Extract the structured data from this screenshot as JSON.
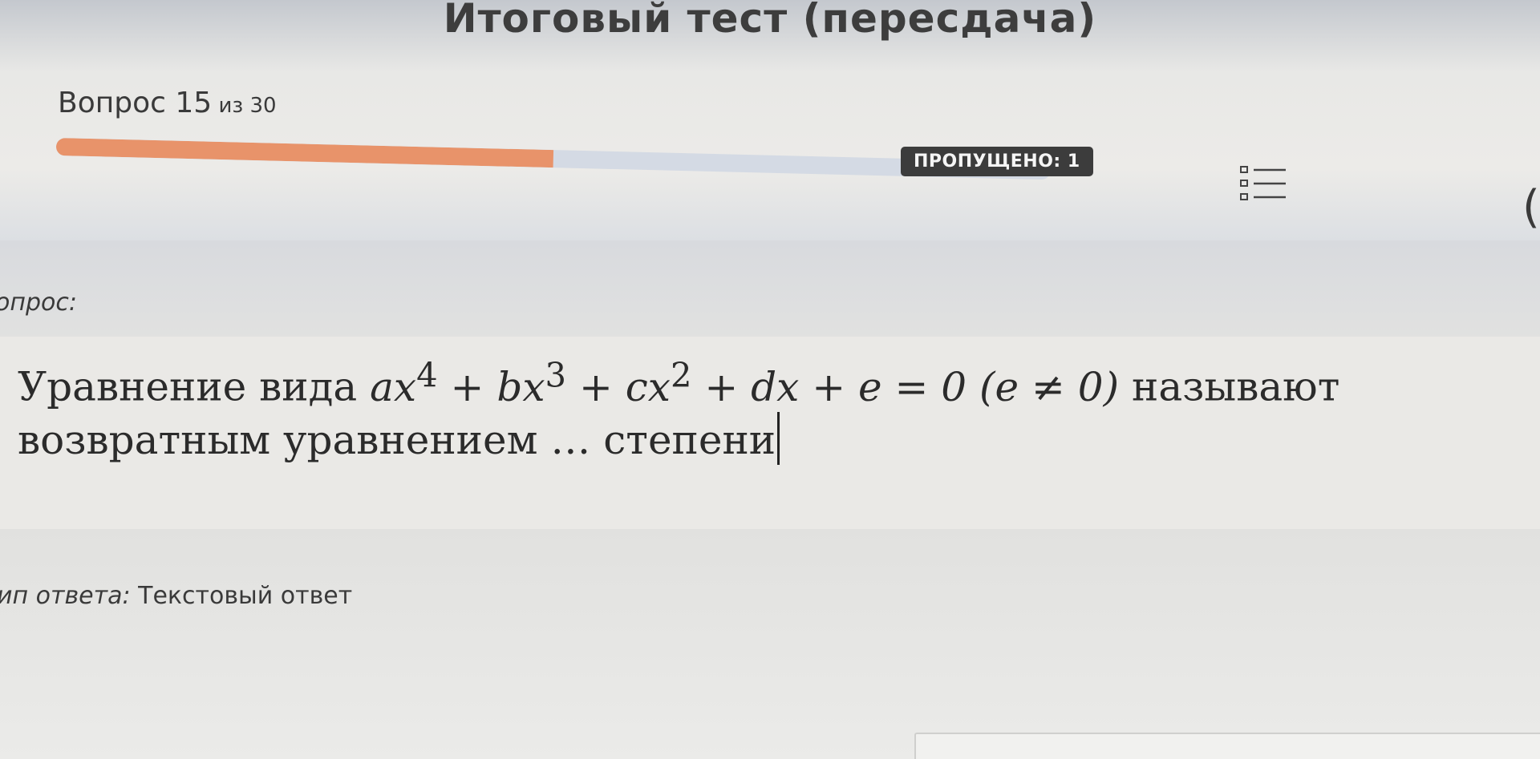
{
  "header": {
    "title": "Итоговый тест (пересдача)",
    "question_prefix": "Вопрос ",
    "question_number": "15",
    "question_total": " из 30",
    "progress": 0.5,
    "skipped_label": "ПРОПУЩЕНО: 1",
    "list_icon": "question-list-icon"
  },
  "edge_fragment": "(",
  "question": {
    "label": "опрос:",
    "text_before": "Уравнение вида ",
    "equation_parts": {
      "t1": "ax",
      "e1": "4",
      "t2": " + bx",
      "e2": "3",
      "t3": " + cx",
      "e3": "2",
      "t4": " + dx + e = 0 (e ≠ 0)"
    },
    "text_after": " называют возвратным уравнением … степени"
  },
  "answer": {
    "type_label": "ип ответа:",
    "type_value": " Текстовый ответ",
    "input_value": ""
  },
  "colors": {
    "progress_fill": "#e8936a",
    "progress_track": "#d4dae4",
    "badge_background": "#3c3c3c"
  }
}
